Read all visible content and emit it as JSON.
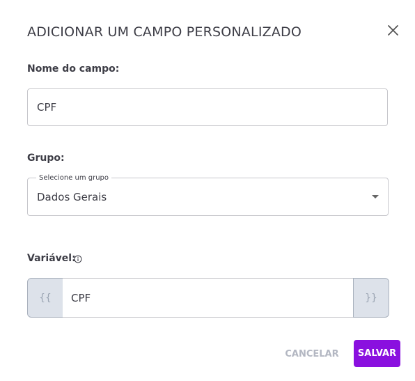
{
  "dialog": {
    "title": "ADICIONAR UM CAMPO PERSONALIZADO",
    "close_icon": "close-icon"
  },
  "field_name": {
    "label": "Nome do campo:",
    "value": "CPF"
  },
  "group": {
    "label": "Grupo:",
    "select_legend": "Selecione um grupo",
    "selected": "Dados Gerais",
    "caret_icon": "caret-down-icon"
  },
  "variable": {
    "label": "Variável:",
    "info_icon": "info-icon",
    "prefix": "{{",
    "value": "CPF",
    "suffix": "}}"
  },
  "actions": {
    "cancel_label": "CANCELAR",
    "save_label": "SALVAR"
  },
  "colors": {
    "primary": "#8a10df",
    "cancel_text": "#b3b7c2",
    "addon_bg": "#dde2ea"
  }
}
